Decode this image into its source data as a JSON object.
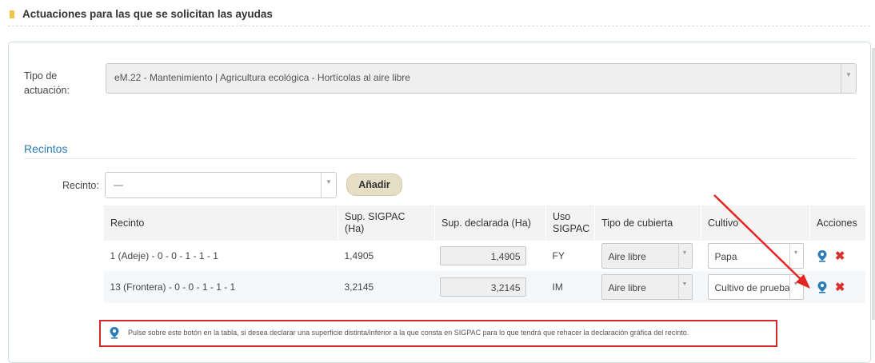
{
  "section": {
    "title": "Actuaciones para las que se solicitan las ayudas"
  },
  "tipo_actuacion": {
    "label": "Tipo de actuación:",
    "value": "eM.22 - Mantenimiento | Agricultura ecológica - Hortícolas al aire libre"
  },
  "recintos": {
    "title": "Recintos",
    "label": "Recinto:",
    "select_value": "—",
    "add_button": "Añadir"
  },
  "table": {
    "headers": {
      "recinto": "Recinto",
      "sup_sigpac": "Sup. SIGPAC (Ha)",
      "sup_declarada": "Sup. declarada (Ha)",
      "uso_sigpac": "Uso SIGPAC",
      "tipo_cubierta": "Tipo de cubierta",
      "cultivo": "Cultivo",
      "acciones": "Acciones"
    },
    "rows": [
      {
        "recinto": "1 (Adeje) - 0 - 0 - 1 - 1 - 1",
        "sup_sigpac": "1,4905",
        "sup_declarada": "1,4905",
        "uso": "FY",
        "cubierta": "Aire libre",
        "cultivo": "Papa"
      },
      {
        "recinto": "13 (Frontera) - 0 - 0 - 1 - 1 - 1",
        "sup_sigpac": "3,2145",
        "sup_declarada": "3,2145",
        "uso": "IM",
        "cubierta": "Aire libre",
        "cultivo": "Cultivo de prueba"
      }
    ]
  },
  "note": {
    "text": "Pulse sobre este botón en la tabla, si desea declarar una superficie distinta/inferior a la que consta en SIGPAC para lo que tendrá que rehacer la declaración gráfica del recinto."
  },
  "icons": {
    "pin": "map-marker-icon",
    "delete": "close-icon",
    "dropdown": "chevron-down-icon"
  },
  "colors": {
    "accent_blue": "#2c7cb8",
    "annotation_red": "#d5262a",
    "delete_red": "#d9302c",
    "button_beige": "#e6dfc6"
  }
}
